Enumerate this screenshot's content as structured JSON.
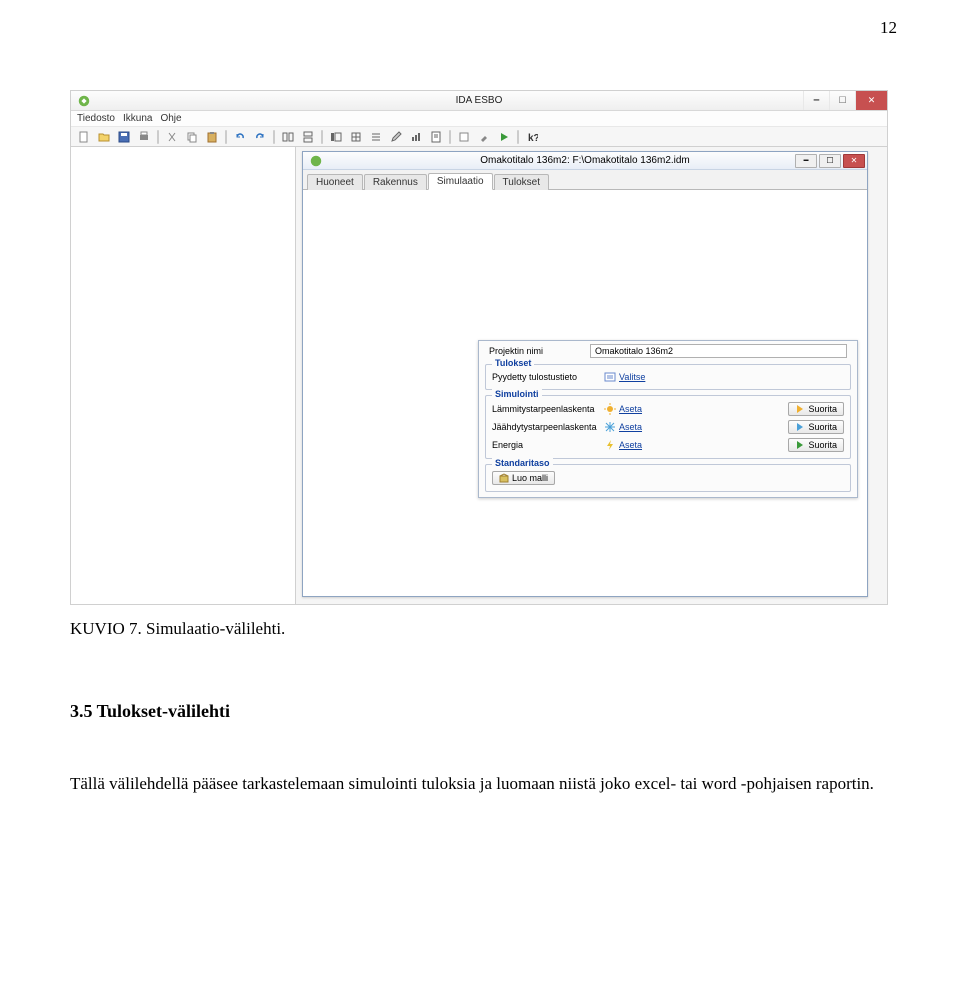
{
  "page_number": "12",
  "app": {
    "title": "IDA ESBO",
    "menu": [
      "Tiedosto",
      "Ikkuna",
      "Ohje"
    ]
  },
  "doc": {
    "title": "Omakotitalo 136m2: F:\\Omakotitalo 136m2.idm",
    "tabs": [
      "Huoneet",
      "Rakennus",
      "Simulaatio",
      "Tulokset"
    ],
    "active_tab": 2
  },
  "form": {
    "project_label": "Projektin nimi",
    "project_value": "Omakotitalo 136m2",
    "group_results": {
      "legend": "Tulokset",
      "row_label": "Pyydetty tulostustieto",
      "link": "Valitse"
    },
    "group_sim": {
      "legend": "Simulointi",
      "rows": [
        {
          "label": "Lämmitystarpeenlaskenta",
          "link": "Aseta",
          "btn": "Suorita"
        },
        {
          "label": "Jäähdytystarpeenlaskenta",
          "link": "Aseta",
          "btn": "Suorita"
        },
        {
          "label": "Energia",
          "link": "Aseta",
          "btn": "Suorita"
        }
      ]
    },
    "group_std": {
      "legend": "Standaritaso",
      "btn": "Luo malli"
    }
  },
  "caption": "KUVIO 7. Simulaatio-välilehti.",
  "section_heading": "3.5  Tulokset-välilehti",
  "body": "Tällä välilehdellä pääsee tarkastelemaan simulointi tuloksia ja luomaan niistä joko excel- tai word -pohjaisen raportin."
}
